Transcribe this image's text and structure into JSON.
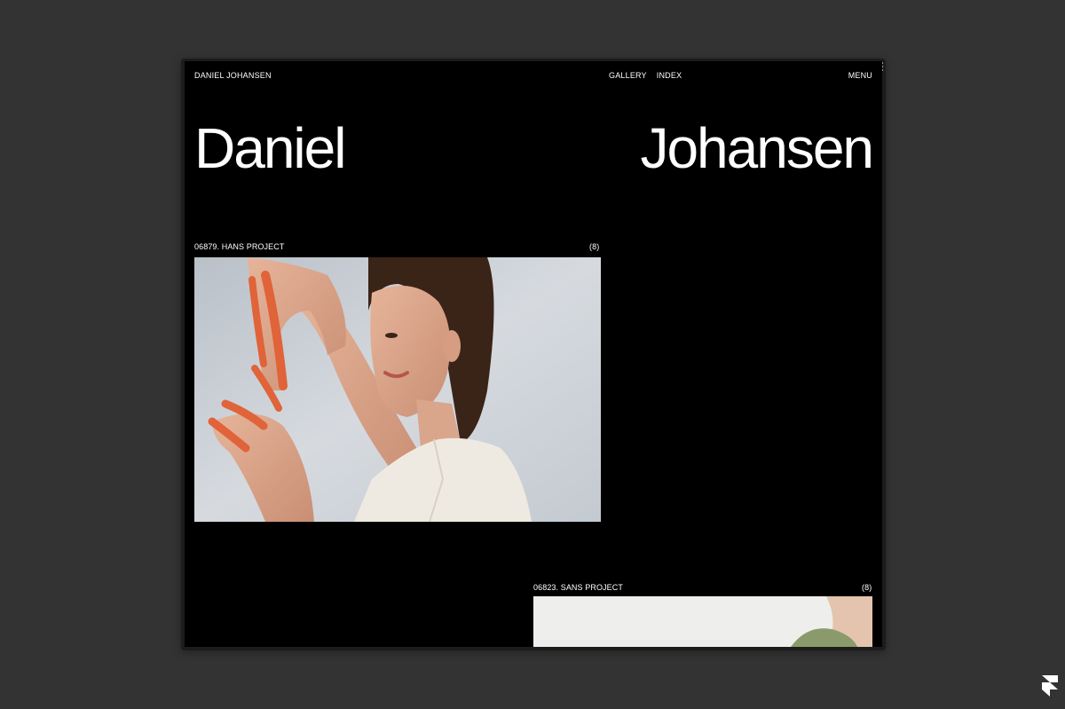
{
  "header": {
    "brand": "DANIEL JOHANSEN",
    "nav": [
      "GALLERY",
      "INDEX"
    ],
    "menu": "MENU"
  },
  "hero": {
    "first_name": "Daniel",
    "last_name": "Johansen"
  },
  "projects": [
    {
      "title": "06879. HANS PROJECT",
      "count": "(8)"
    },
    {
      "title": "06823. SANS PROJECT",
      "count": "(8)"
    }
  ],
  "colors": {
    "page_background": "#333333",
    "screen_background": "#000000",
    "text": "#ffffff",
    "accent_orange": "#e0633a"
  },
  "icons": {
    "corner_logo": "framer-logo-icon"
  }
}
